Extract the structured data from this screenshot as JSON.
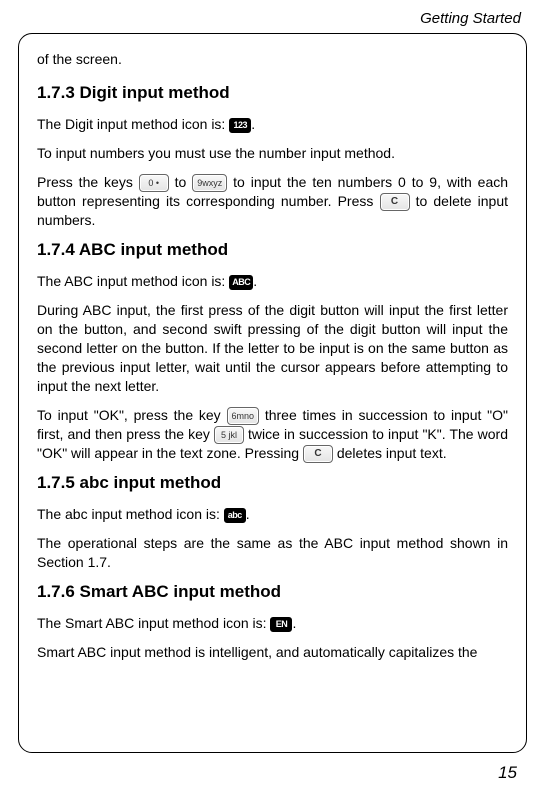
{
  "header": "Getting Started",
  "frag_top": "of the screen.",
  "s173": {
    "title": "1.7.3 Digit input method",
    "p1a": "The Digit input method icon is: ",
    "icon": "123",
    "p1b": ".",
    "p2": "To input numbers you must use the number input method.",
    "p3a": "Press the keys ",
    "key0": "0 •",
    "p3b": " to ",
    "key9": "9wxyz",
    "p3c": " to input the ten numbers 0 to 9, with each button representing its corresponding number. Press ",
    "keyc": "C",
    "p3d": " to delete input numbers."
  },
  "s174": {
    "title": "1.7.4 ABC input method",
    "p1a": "The ABC input method icon is: ",
    "icon": "ABC",
    "p1b": ".",
    "p2": "During ABC input, the first press of the digit button will input the first letter on the button, and second swift pressing of the digit button will input the second letter on the button. If the letter to be input is on the same button as the previous input letter, wait until the cursor appears before attempting to input the next letter.",
    "p3a": "To input \"OK\", press the key ",
    "key6": "6mno",
    "p3b": " three times in succession to input \"O\" first, and then press the key ",
    "key5": "5 jkl",
    "p3c": "  twice in succession to input \"K\". The word \"OK\" will appear in the text zone. Pressing ",
    "keyc": "C",
    "p3d": " deletes input text."
  },
  "s175": {
    "title": "1.7.5 abc input method",
    "p1a": "The abc input method icon is: ",
    "icon": "abc",
    "p1b": ".",
    "p2": "The operational steps are the same as the ABC input method shown in Section 1.7."
  },
  "s176": {
    "title": "1.7.6 Smart ABC input method",
    "p1a": "The Smart ABC input method icon is: ",
    "icon": "EN",
    "p1b": ".",
    "p2": "Smart ABC input method is intelligent, and automatically capitalizes the"
  },
  "page_number": "15"
}
